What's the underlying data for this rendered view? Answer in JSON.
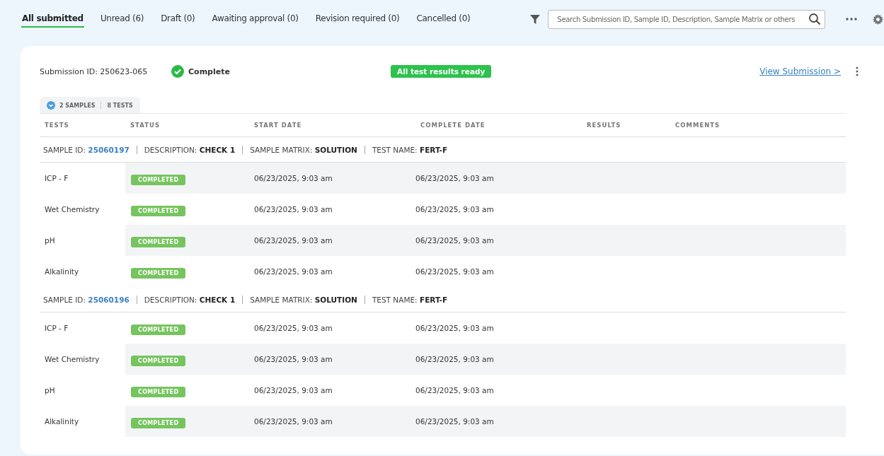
{
  "tabs": [
    {
      "label": "All submitted",
      "selected": true
    },
    {
      "label": "Unread (6)",
      "selected": false
    },
    {
      "label": "Draft (0)",
      "selected": false
    },
    {
      "label": "Awaiting approval (0)",
      "selected": false
    },
    {
      "label": "Revision required (0)",
      "selected": false
    },
    {
      "label": "Cancelled (0)",
      "selected": false
    }
  ],
  "search": {
    "placeholder": "Search Submission ID, Sample ID, Description, Sample Matrix or others"
  },
  "submission": {
    "id_label": "Submission ID: 250623-065",
    "status": "Complete",
    "badge": "All test results ready",
    "link": "View Submission >"
  },
  "summary": {
    "expanded": true,
    "samples": "2 SAMPLES",
    "tests": "8 TESTS"
  },
  "table": {
    "columns": [
      "TESTS",
      "STATUS",
      "START DATE",
      "COMPLETE DATE",
      "RESULTS",
      "COMMENTS"
    ],
    "groups": [
      {
        "sample_id_label": "SAMPLE ID:",
        "sample_id": "25060197",
        "description_label": "DESCRIPTION:",
        "description": "CHECK 1",
        "matrix_label": "SAMPLE MATRIX:",
        "matrix": "SOLUTION",
        "test_name_label": "TEST NAME:",
        "test_name": "FERT-F",
        "rows": [
          {
            "test": "ICP - F",
            "status": "COMPLETED",
            "start": "06/23/2025, 9:03 am",
            "complete": "06/23/2025, 9:03 am"
          },
          {
            "test": "Wet Chemistry",
            "status": "COMPLETED",
            "start": "06/23/2025, 9:03 am",
            "complete": "06/23/2025, 9:03 am"
          },
          {
            "test": "pH",
            "status": "COMPLETED",
            "start": "06/23/2025, 9:03 am",
            "complete": "06/23/2025, 9:03 am"
          },
          {
            "test": "Alkalinity",
            "status": "COMPLETED",
            "start": "06/23/2025, 9:03 am",
            "complete": "06/23/2025, 9:03 am"
          }
        ]
      },
      {
        "sample_id_label": "SAMPLE ID:",
        "sample_id": "25060196",
        "description_label": "DESCRIPTION:",
        "description": "CHECK 1",
        "matrix_label": "SAMPLE MATRIX:",
        "matrix": "SOLUTION",
        "test_name_label": "TEST NAME:",
        "test_name": "FERT-F",
        "rows": [
          {
            "test": "ICP - F",
            "status": "COMPLETED",
            "start": "06/23/2025, 9:03 am",
            "complete": "06/23/2025, 9:03 am"
          },
          {
            "test": "Wet Chemistry",
            "status": "COMPLETED",
            "start": "06/23/2025, 9:03 am",
            "complete": "06/23/2025, 9:03 am"
          },
          {
            "test": "pH",
            "status": "COMPLETED",
            "start": "06/23/2025, 9:03 am",
            "complete": "06/23/2025, 9:03 am"
          },
          {
            "test": "Alkalinity",
            "status": "COMPLETED",
            "start": "06/23/2025, 9:03 am",
            "complete": "06/23/2025, 9:03 am"
          }
        ]
      }
    ]
  }
}
